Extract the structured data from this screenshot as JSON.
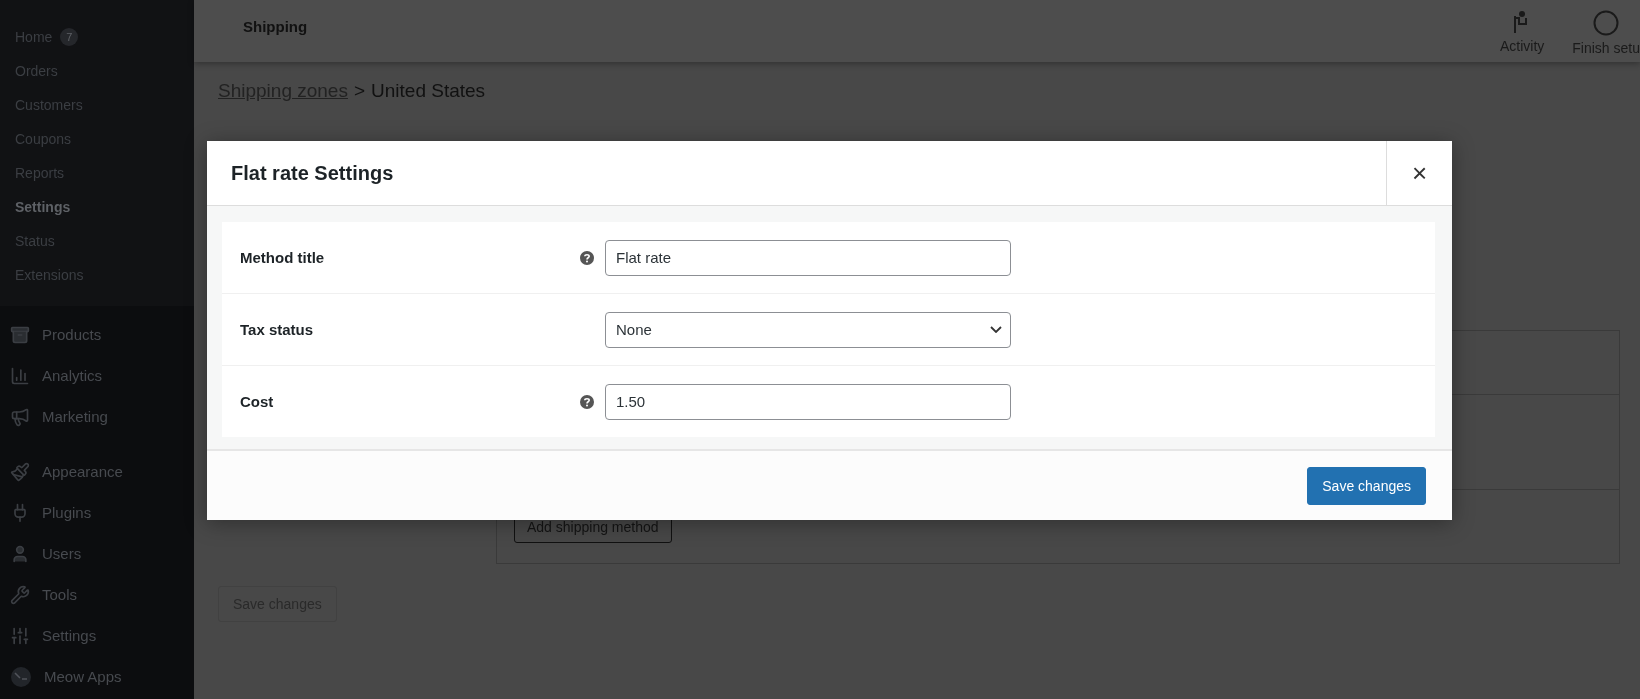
{
  "header": {
    "title": "Shipping",
    "actions": [
      {
        "label": "Activity",
        "kind": "flag"
      },
      {
        "label": "Finish setu",
        "kind": "circle"
      }
    ]
  },
  "sidebar": {
    "submenu": [
      {
        "label": "Home",
        "badge": "7",
        "selected": false
      },
      {
        "label": "Orders",
        "selected": false
      },
      {
        "label": "Customers",
        "selected": false
      },
      {
        "label": "Coupons",
        "selected": false
      },
      {
        "label": "Reports",
        "selected": false
      },
      {
        "label": "Settings",
        "selected": true
      },
      {
        "label": "Status",
        "selected": false
      },
      {
        "label": "Extensions",
        "selected": false
      }
    ],
    "menu": [
      {
        "label": "Products",
        "kind": "box"
      },
      {
        "label": "Analytics",
        "kind": "chart"
      },
      {
        "label": "Marketing",
        "kind": "megaphone"
      },
      {
        "label": "Appearance",
        "kind": "brush"
      },
      {
        "label": "Plugins",
        "kind": "plug"
      },
      {
        "label": "Users",
        "kind": "user"
      },
      {
        "label": "Tools",
        "kind": "wrench"
      },
      {
        "label": "Settings",
        "kind": "sliders"
      },
      {
        "label": "Meow Apps",
        "kind": "logo"
      }
    ]
  },
  "breadcrumb": {
    "link": "Shipping zones",
    "separator": ">",
    "current": "United States"
  },
  "zone": {
    "add_button": "Add shipping method",
    "save_button": {
      "label": "Save changes",
      "disabled": true
    }
  },
  "modal": {
    "title": "Flat rate Settings",
    "close": "×",
    "fields": [
      {
        "label": "Method title",
        "kind": "text",
        "help": true,
        "value": "Flat rate"
      },
      {
        "label": "Tax status",
        "kind": "select",
        "help": false,
        "value": "None"
      },
      {
        "label": "Cost",
        "kind": "text",
        "help": true,
        "value": "1.50"
      }
    ],
    "save_button": "Save changes"
  }
}
